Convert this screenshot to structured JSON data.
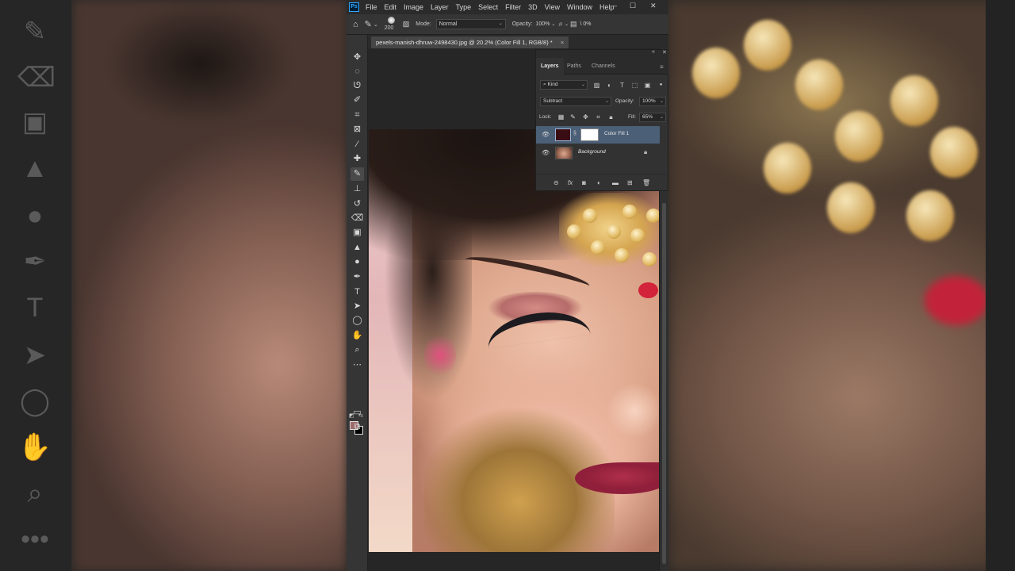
{
  "app": {
    "menu": [
      "File",
      "Edit",
      "Image",
      "Layer",
      "Type",
      "Select",
      "Filter",
      "3D",
      "View",
      "Window",
      "Help"
    ],
    "logo_text": "Ps",
    "window_controls": [
      "–",
      "☐",
      "✕"
    ]
  },
  "options_bar": {
    "brush_size": "200",
    "mode_label": "Mode:",
    "mode_value": "Normal",
    "opacity_label": "Opacity:",
    "opacity_value": "100%",
    "extra_value": "\\ 0%"
  },
  "document": {
    "tab_title": "pexels-manish-dhruw-2498430.jpg @ 20.2% (Color Fill 1, RGB/8) *",
    "tab_close": "×"
  },
  "toolbar": {
    "tools": [
      "move-tool",
      "marquee-tool",
      "lasso-tool",
      "quick-select-tool",
      "crop-tool",
      "frame-tool",
      "eyedropper-tool",
      "healing-tool",
      "brush-tool",
      "stamp-tool",
      "history-brush-tool",
      "eraser-tool",
      "gradient-tool",
      "blur-tool",
      "dodge-tool",
      "pen-tool",
      "type-tool",
      "path-select-tool",
      "shape-tool",
      "hand-tool",
      "zoom-tool",
      "more-tools"
    ],
    "active_tool": "brush-tool",
    "foreground_color": "#9d6a6c",
    "background_color": "#000000"
  },
  "layers_panel": {
    "tabs": [
      "Layers",
      "Paths",
      "Channels"
    ],
    "active_tab": "Layers",
    "filter_kind": "Kind",
    "blend_mode": "Subtract",
    "opacity_label": "Opacity:",
    "opacity_value": "100%",
    "lock_label": "Lock:",
    "fill_label": "Fill:",
    "fill_value": "65%",
    "layers": [
      {
        "name": "Color Fill 1",
        "selected": true,
        "fill_color": "#3a0d14"
      },
      {
        "name": "Background",
        "selected": false,
        "locked": true
      }
    ]
  },
  "colors": {
    "accent_selected": "#4b5f77",
    "ps_brand": "#31a8ff",
    "bindi": "#d2233a"
  }
}
